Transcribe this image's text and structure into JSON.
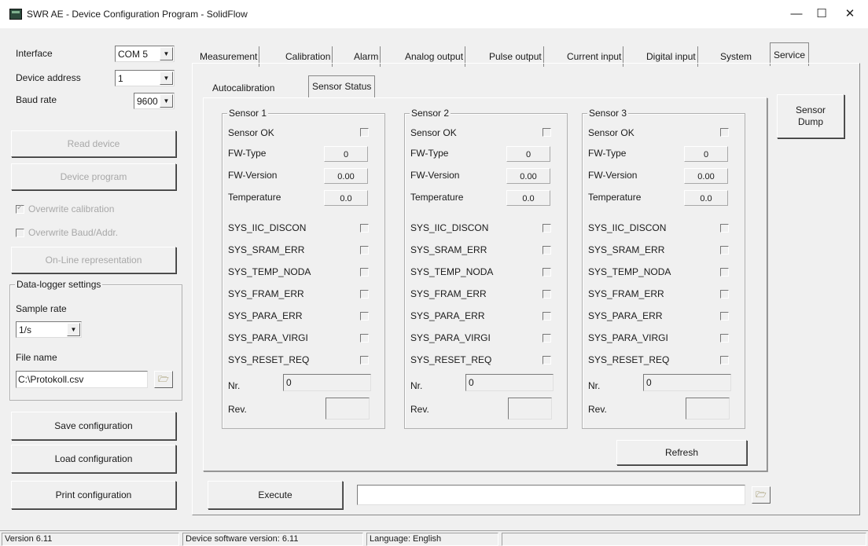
{
  "window": {
    "title": "SWR AE - Device Configuration Program - SolidFlow",
    "minimize": "—",
    "maximize": "☐",
    "close": "✕"
  },
  "left": {
    "interface_label": "Interface",
    "interface_value": "COM 5",
    "address_label": "Device address",
    "address_value": "1",
    "baud_label": "Baud rate",
    "baud_value": "9600",
    "read_device": "Read device",
    "device_program": "Device program",
    "overwrite_calibration": "Overwrite calibration",
    "overwrite_baud": "Overwrite Baud/Addr.",
    "online_representation": "On-Line representation",
    "datalogger_title": "Data-logger settings",
    "sample_rate_label": "Sample rate",
    "sample_rate_value": "1/s",
    "file_name_label": "File name",
    "file_name_value": "C:\\Protokoll.csv",
    "save_configuration": "Save configuration",
    "load_configuration": "Load configuration",
    "print_configuration": "Print configuration"
  },
  "tabs": [
    "Measurement",
    "Calibration",
    "Alarm",
    "Analog output",
    "Pulse output",
    "Current input",
    "Digital input",
    "System",
    "Service"
  ],
  "active_tab": "Service",
  "subtabs": [
    "Autocalibration",
    "Sensor Status"
  ],
  "active_subtab": "Sensor Status",
  "row_labels": {
    "sensor_ok": "Sensor OK",
    "fw_type": "FW-Type",
    "fw_version": "FW-Version",
    "temperature": "Temperature",
    "flags": [
      "SYS_IIC_DISCON",
      "SYS_SRAM_ERR",
      "SYS_TEMP_NODA",
      "SYS_FRAM_ERR",
      "SYS_PARA_ERR",
      "SYS_PARA_VIRGI",
      "SYS_RESET_REQ"
    ],
    "nr": "Nr.",
    "rev": "Rev."
  },
  "sensors": [
    {
      "title": "Sensor 1",
      "fw_type": "0",
      "fw_version": "0.00",
      "temperature": "0.0",
      "nr": "0",
      "rev": ""
    },
    {
      "title": "Sensor 2",
      "fw_type": "0",
      "fw_version": "0.00",
      "temperature": "0.0",
      "nr": "0",
      "rev": ""
    },
    {
      "title": "Sensor 3",
      "fw_type": "0",
      "fw_version": "0.00",
      "temperature": "0.0",
      "nr": "0",
      "rev": ""
    }
  ],
  "sensor_dump": "Sensor Dump",
  "refresh": "Refresh",
  "execute": "Execute",
  "command_value": "",
  "status": {
    "version": "Version 6.11",
    "device_sw": "Device software version: 6.11",
    "language": "Language: English"
  }
}
